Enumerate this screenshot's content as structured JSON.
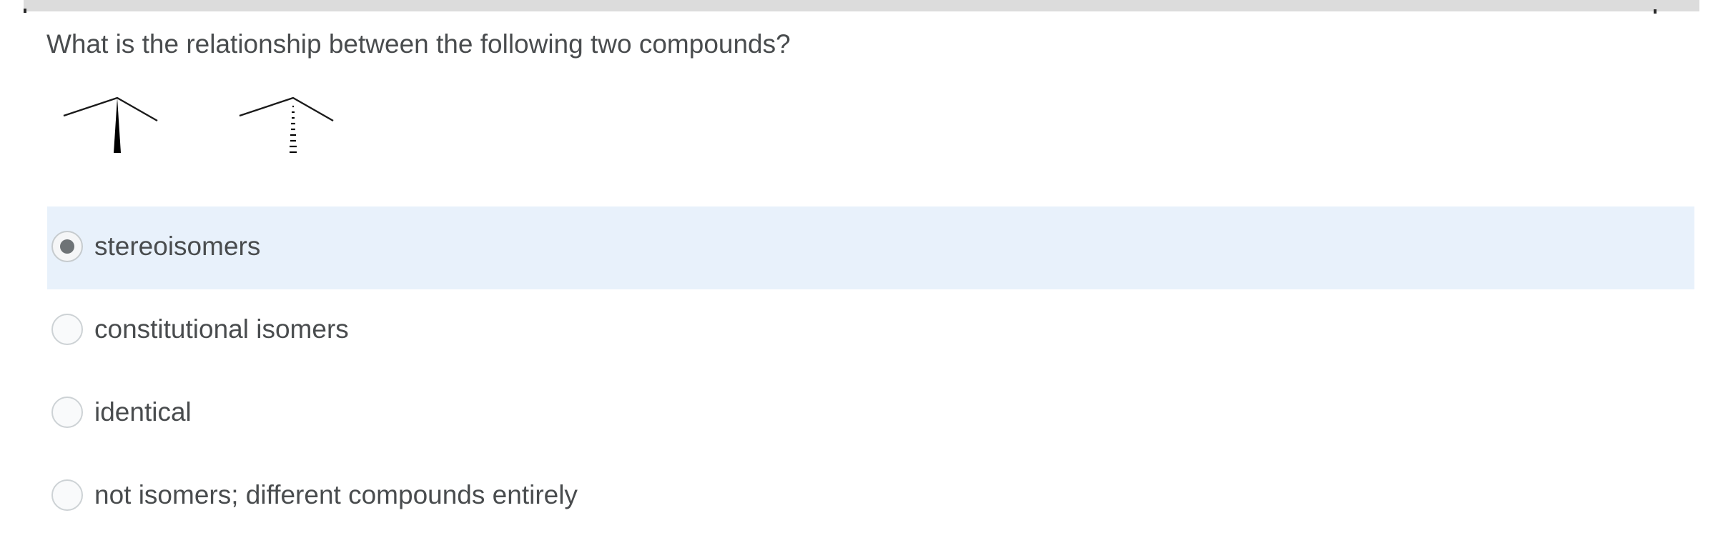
{
  "question": {
    "text": "What is the relationship between the following two compounds?"
  },
  "structures": [
    {
      "name": "wedge-bond-compound",
      "bond": "wedge"
    },
    {
      "name": "dash-bond-compound",
      "bond": "dash"
    }
  ],
  "options": [
    {
      "label": "stereoisomers",
      "selected": true
    },
    {
      "label": "constitutional isomers",
      "selected": false
    },
    {
      "label": "identical",
      "selected": false
    },
    {
      "label": "not isomers; different compounds entirely",
      "selected": false
    }
  ],
  "colors": {
    "selected_background": "#e8f1fb",
    "text": "#494c4e",
    "top_bar": "#dcdcdc"
  }
}
